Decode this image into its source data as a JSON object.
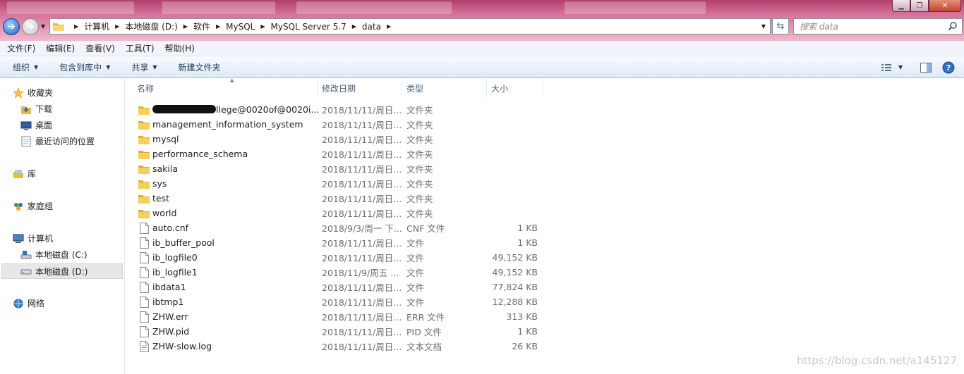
{
  "address_bar": {
    "crumbs": [
      "计算机",
      "本地磁盘 (D:)",
      "软件",
      "MySQL",
      "MySQL Server 5.7",
      "data"
    ]
  },
  "search": {
    "placeholder": "搜索 data"
  },
  "menu": [
    "文件(F)",
    "编辑(E)",
    "查看(V)",
    "工具(T)",
    "帮助(H)"
  ],
  "toolbar": {
    "organize": "组织",
    "include_in_library": "包含到库中",
    "share": "共享",
    "new_folder": "新建文件夹"
  },
  "nav": {
    "favorites": "收藏夹",
    "downloads": "下载",
    "desktop": "桌面",
    "recent": "最近访问的位置",
    "libraries": "库",
    "homegroup": "家庭组",
    "computer": "计算机",
    "drive_c": "本地磁盘 (C:)",
    "drive_d": "本地磁盘 (D:)",
    "network": "网络"
  },
  "columns": {
    "name": "名称",
    "date": "修改日期",
    "type": "类型",
    "size": "大小"
  },
  "files": [
    {
      "name": "llege@0020of@0020i...",
      "date": "2018/11/11/周日...",
      "type": "文件夹",
      "size": "",
      "kind": "folder",
      "redacted": true
    },
    {
      "name": "management_information_system",
      "date": "2018/11/11/周日...",
      "type": "文件夹",
      "size": "",
      "kind": "folder"
    },
    {
      "name": "mysql",
      "date": "2018/11/11/周日...",
      "type": "文件夹",
      "size": "",
      "kind": "folder"
    },
    {
      "name": "performance_schema",
      "date": "2018/11/11/周日...",
      "type": "文件夹",
      "size": "",
      "kind": "folder"
    },
    {
      "name": "sakila",
      "date": "2018/11/11/周日...",
      "type": "文件夹",
      "size": "",
      "kind": "folder"
    },
    {
      "name": "sys",
      "date": "2018/11/11/周日...",
      "type": "文件夹",
      "size": "",
      "kind": "folder"
    },
    {
      "name": "test",
      "date": "2018/11/11/周日...",
      "type": "文件夹",
      "size": "",
      "kind": "folder"
    },
    {
      "name": "world",
      "date": "2018/11/11/周日...",
      "type": "文件夹",
      "size": "",
      "kind": "folder"
    },
    {
      "name": "auto.cnf",
      "date": "2018/9/3/周一 下...",
      "type": "CNF 文件",
      "size": "1 KB",
      "kind": "file"
    },
    {
      "name": "ib_buffer_pool",
      "date": "2018/11/11/周日...",
      "type": "文件",
      "size": "1 KB",
      "kind": "file"
    },
    {
      "name": "ib_logfile0",
      "date": "2018/11/11/周日...",
      "type": "文件",
      "size": "49,152 KB",
      "kind": "file"
    },
    {
      "name": "ib_logfile1",
      "date": "2018/11/9/周五 ...",
      "type": "文件",
      "size": "49,152 KB",
      "kind": "file"
    },
    {
      "name": "ibdata1",
      "date": "2018/11/11/周日...",
      "type": "文件",
      "size": "77,824 KB",
      "kind": "file"
    },
    {
      "name": "ibtmp1",
      "date": "2018/11/11/周日...",
      "type": "文件",
      "size": "12,288 KB",
      "kind": "file"
    },
    {
      "name": "ZHW.err",
      "date": "2018/11/11/周日...",
      "type": "ERR 文件",
      "size": "313 KB",
      "kind": "file"
    },
    {
      "name": "ZHW.pid",
      "date": "2018/11/11/周日...",
      "type": "PID 文件",
      "size": "1 KB",
      "kind": "file"
    },
    {
      "name": "ZHW-slow.log",
      "date": "2018/11/11/周日...",
      "type": "文本文档",
      "size": "26 KB",
      "kind": "textfile"
    }
  ],
  "watermark": "https://blog.csdn.net/a145127",
  "colors": {
    "title_pink": "#d46d98",
    "header_text": "#4c607a",
    "folder": "#f2c94c"
  }
}
